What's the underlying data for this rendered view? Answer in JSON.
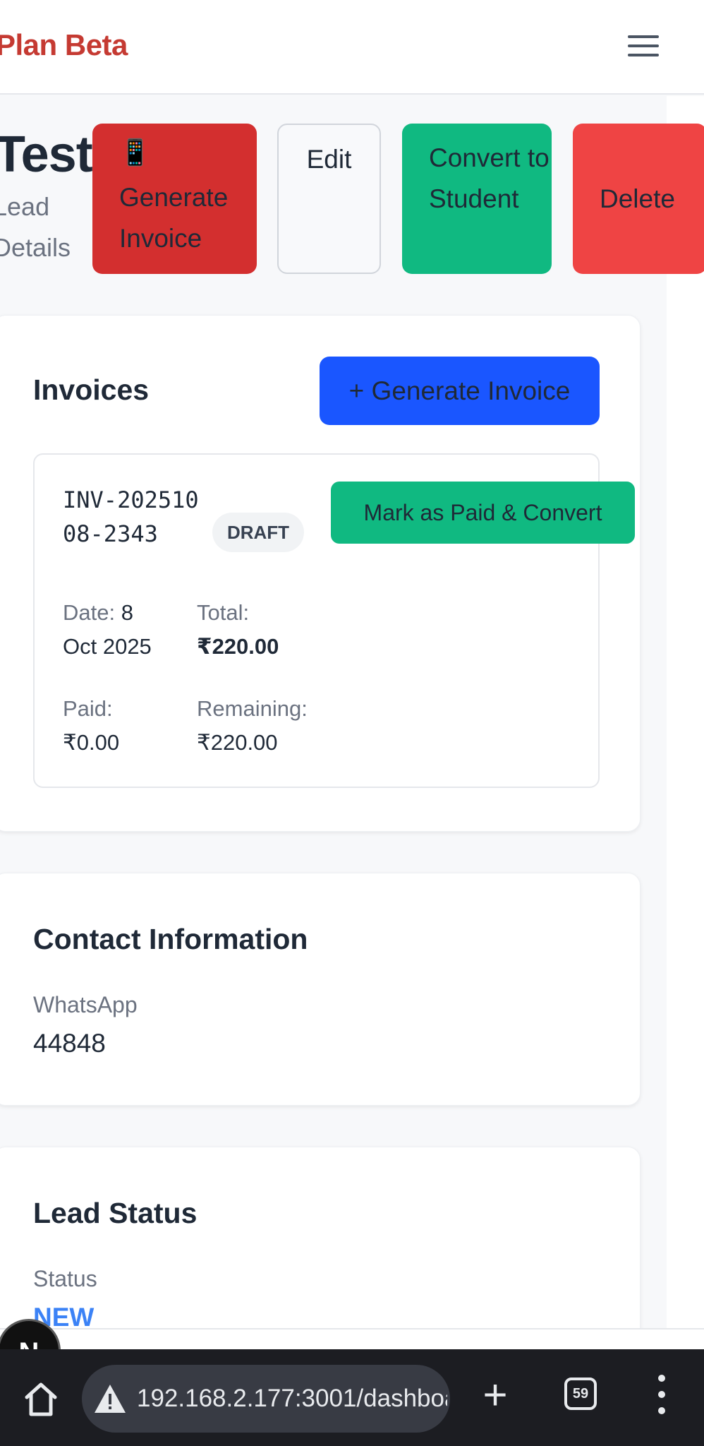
{
  "header": {
    "brand": "Plan Beta",
    "menu_icon": "hamburger-menu-icon"
  },
  "lead": {
    "name": "Test",
    "subtitle": "Lead Details"
  },
  "actions": {
    "generate_invoice_icon": "📱",
    "generate_invoice": "Generate Invoice",
    "edit": "Edit",
    "convert": "Convert to Student",
    "delete": "Delete"
  },
  "invoices": {
    "title": "Invoices",
    "new_button": "+ Generate Invoice",
    "items": [
      {
        "number": "INV-20251008-2343",
        "status": "DRAFT",
        "mark_paid_button": "Mark as Paid & Convert",
        "date_label": "Date:",
        "date_value": "8 Oct 2025",
        "total_label": "Total:",
        "total_value": "₹220.00",
        "paid_label": "Paid:",
        "paid_value": "₹0.00",
        "remaining_label": "Remaining:",
        "remaining_value": "₹220.00"
      }
    ]
  },
  "contact": {
    "title": "Contact Information",
    "whatsapp_label": "WhatsApp",
    "whatsapp_value": "44848"
  },
  "lead_status": {
    "title": "Lead Status",
    "status_label": "Status",
    "status_value": "NEW"
  },
  "avatar": {
    "initial": "N"
  },
  "browser": {
    "url": "192.168.2.177:3001/dashboa",
    "tab_count": "59"
  },
  "colors": {
    "brand": "#c53a32",
    "generate_red": "#d32f2f",
    "convert_green": "#10b981",
    "delete_red": "#ef4444",
    "primary_blue": "#1a56ff",
    "status_blue": "#3b82f6"
  }
}
